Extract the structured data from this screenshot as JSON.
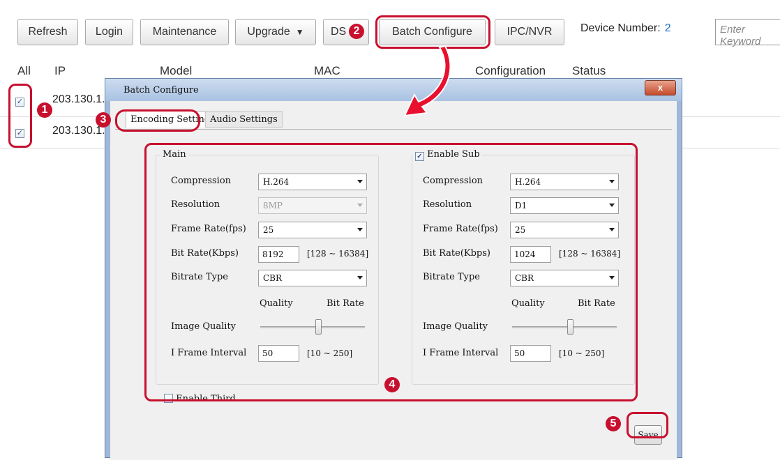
{
  "toolbar": {
    "refresh": "Refresh",
    "login": "Login",
    "maintenance": "Maintenance",
    "upgrade": "Upgrade",
    "ds": "DS",
    "batch_configure": "Batch Configure",
    "ipc_nvr": "IPC/NVR",
    "device_number_label": "Device Number:",
    "device_number_value": "2",
    "search_placeholder": "Enter Keyword"
  },
  "table": {
    "headers": [
      "All",
      "IP",
      "Model",
      "MAC",
      "Configuration",
      "Status"
    ],
    "rows": [
      {
        "ip": "203.130.1.",
        "checked": true
      },
      {
        "ip": "203.130.1.",
        "checked": true
      }
    ]
  },
  "callouts": [
    "1",
    "2",
    "3",
    "4",
    "5"
  ],
  "dialog": {
    "title": "Batch Configure",
    "close": "x",
    "tabs": [
      "Encoding Settings",
      "Audio Settings"
    ],
    "main": {
      "label": "Main",
      "compression_label": "Compression",
      "compression": "H.264",
      "resolution_label": "Resolution",
      "resolution": "8MP",
      "frame_rate_label": "Frame Rate(fps)",
      "frame_rate": "25",
      "bit_rate_label": "Bit Rate(Kbps)",
      "bit_rate": "8192",
      "bit_rate_range": "[128 ~ 16384]",
      "bitrate_type_label": "Bitrate Type",
      "bitrate_type": "CBR",
      "quality_label": "Quality",
      "bitrate_end_label": "Bit Rate",
      "image_quality_label": "Image Quality",
      "image_quality_level": 0.55,
      "iframe_label": "I Frame Interval",
      "iframe": "50",
      "iframe_range": "[10 ~ 250]"
    },
    "sub": {
      "label": "Enable Sub",
      "enabled": true,
      "compression_label": "Compression",
      "compression": "H.264",
      "resolution_label": "Resolution",
      "resolution": "D1",
      "frame_rate_label": "Frame Rate(fps)",
      "frame_rate": "25",
      "bit_rate_label": "Bit Rate(Kbps)",
      "bit_rate": "1024",
      "bit_rate_range": "[128 ~ 16384]",
      "bitrate_type_label": "Bitrate Type",
      "bitrate_type": "CBR",
      "quality_label": "Quality",
      "bitrate_end_label": "Bit Rate",
      "image_quality_label": "Image Quality",
      "image_quality_level": 0.55,
      "iframe_label": "I Frame Interval",
      "iframe": "50",
      "iframe_range": "[10 ~ 250]"
    },
    "third": {
      "label": "Enable Third",
      "enabled": false
    },
    "save": "Save"
  },
  "colors": {
    "callout_red": "#c8102e",
    "device_number_blue": "#1a6fc9"
  }
}
